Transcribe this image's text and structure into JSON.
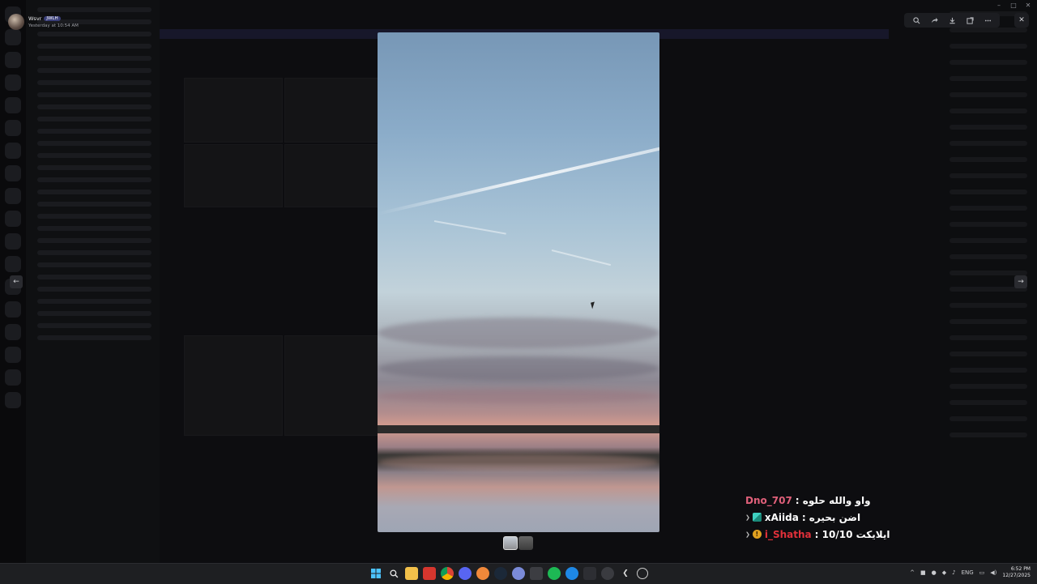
{
  "viewer": {
    "author": "Wsvr",
    "tag": "JWLH",
    "timestamp": "Yesterday at 10:54 AM"
  },
  "toolbar": {
    "icons": [
      "zoom-icon",
      "forward-icon",
      "download-icon",
      "open-in-new-icon",
      "more-icon"
    ],
    "close_label": "✕"
  },
  "window": {
    "minimize": "–",
    "maximize": "□",
    "close": "✕"
  },
  "nav": {
    "prev": "←",
    "next": "→"
  },
  "chat": [
    {
      "user": "Dno_707",
      "user_color": "#e0607a",
      "message": "واو والله حلوه :",
      "badges": []
    },
    {
      "user": "xAiida",
      "user_color": "#ffffff",
      "message": "اضن بحيره :",
      "badges": [
        "chevron",
        "square-badge"
      ]
    },
    {
      "user": "i_Shatha",
      "user_color": "#e0303a",
      "message": "ايلايكت 10/10 :",
      "badges": [
        "chevron",
        "coin-badge"
      ]
    }
  ],
  "taskbar": {
    "apps": [
      "windows-start-icon",
      "search-icon",
      "file-explorer-icon",
      "app-red-icon",
      "chrome-icon",
      "discord-icon",
      "app-orange-icon",
      "steam-icon",
      "vpn-icon",
      "app-grid-icon",
      "spotify-icon",
      "app-blue-icon",
      "keyboard-icon",
      "settings-icon",
      "back-app-icon",
      "speedometer-icon"
    ],
    "tray": {
      "language": "ENG",
      "time": "6:52 PM",
      "date": "12/27/2025"
    }
  },
  "colors": {
    "accent": "#5865f2",
    "background": "#0b0c0e"
  }
}
